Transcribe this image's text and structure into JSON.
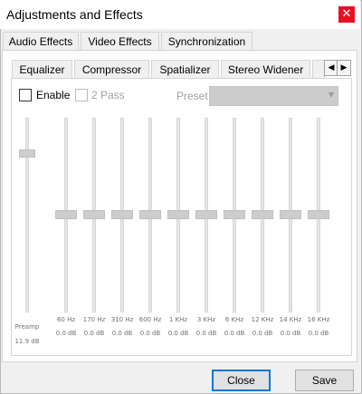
{
  "window": {
    "title": "Adjustments and Effects",
    "close_glyph": "✕"
  },
  "main_tabs": [
    "Audio Effects",
    "Video Effects",
    "Synchronization"
  ],
  "sub_tabs": [
    "Equalizer",
    "Compressor",
    "Spatializer",
    "Stereo Widener"
  ],
  "controls": {
    "enable_label": "Enable",
    "two_pass_label": "2 Pass",
    "preset_label": "Preset",
    "preset_value": ""
  },
  "preamp": {
    "label": "Preamp",
    "value": "11.9 dB"
  },
  "bands": [
    {
      "freq": "60 Hz",
      "gain": "0.0 dB"
    },
    {
      "freq": "170 Hz",
      "gain": "0.0 dB"
    },
    {
      "freq": "310 Hz",
      "gain": "0.0 dB"
    },
    {
      "freq": "600 Hz",
      "gain": "0.0 dB"
    },
    {
      "freq": "1 KHz",
      "gain": "0.0 dB"
    },
    {
      "freq": "3 KHz",
      "gain": "0.0 dB"
    },
    {
      "freq": "6 KHz",
      "gain": "0.0 dB"
    },
    {
      "freq": "12 KHz",
      "gain": "0.0 dB"
    },
    {
      "freq": "14 KHz",
      "gain": "0.0 dB"
    },
    {
      "freq": "16 KHz",
      "gain": "0.0 dB"
    }
  ],
  "buttons": {
    "close": "Close",
    "save": "Save"
  },
  "colors": {
    "accent": "#0078d7",
    "close_red": "#e81123"
  }
}
